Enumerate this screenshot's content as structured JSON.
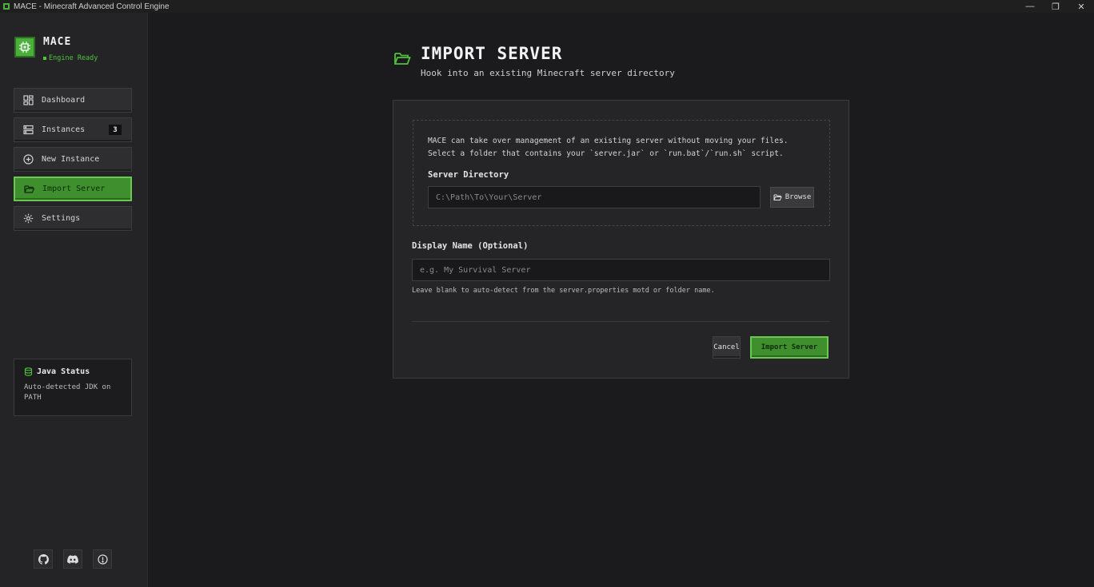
{
  "window": {
    "title": "MACE - Minecraft Advanced Control Engine",
    "controls": {
      "minimize": "—",
      "restore": "❐",
      "close": "✕"
    }
  },
  "brand": {
    "name": "MACE",
    "status": "Engine Ready"
  },
  "sidebar": {
    "items": [
      {
        "label": "Dashboard",
        "icon": "dashboard-grid-icon"
      },
      {
        "label": "Instances",
        "icon": "server-stack-icon",
        "badge": "3"
      },
      {
        "label": "New Instance",
        "icon": "plus-circle-icon"
      },
      {
        "label": "Import Server",
        "icon": "folder-open-icon",
        "active": true
      },
      {
        "label": "Settings",
        "icon": "gear-icon"
      }
    ],
    "java_status": {
      "title": "Java Status",
      "description": "Auto-detected JDK on PATH"
    },
    "social": [
      "github-icon",
      "discord-icon",
      "info-icon"
    ]
  },
  "page": {
    "title": "IMPORT SERVER",
    "subtitle": "Hook into an existing Minecraft server directory",
    "info_line_1": "MACE can take over management of an existing server without moving your files.",
    "info_line_2": "Select a folder that contains your `server.jar` or `run.bat`/`run.sh` script.",
    "server_directory_label": "Server Directory",
    "server_directory_placeholder": "C:\\Path\\To\\Your\\Server",
    "browse_label": "Browse",
    "display_name_label": "Display Name (Optional)",
    "display_name_placeholder": "e.g. My Survival Server",
    "display_name_hint": "Leave blank to auto-detect from the server.properties motd or folder name.",
    "cancel_label": "Cancel",
    "import_label": "Import Server"
  },
  "colors": {
    "accent": "#4caf3c",
    "accent_border": "#68c84f",
    "background": "#1b1b1d",
    "sidebar": "#242426"
  }
}
